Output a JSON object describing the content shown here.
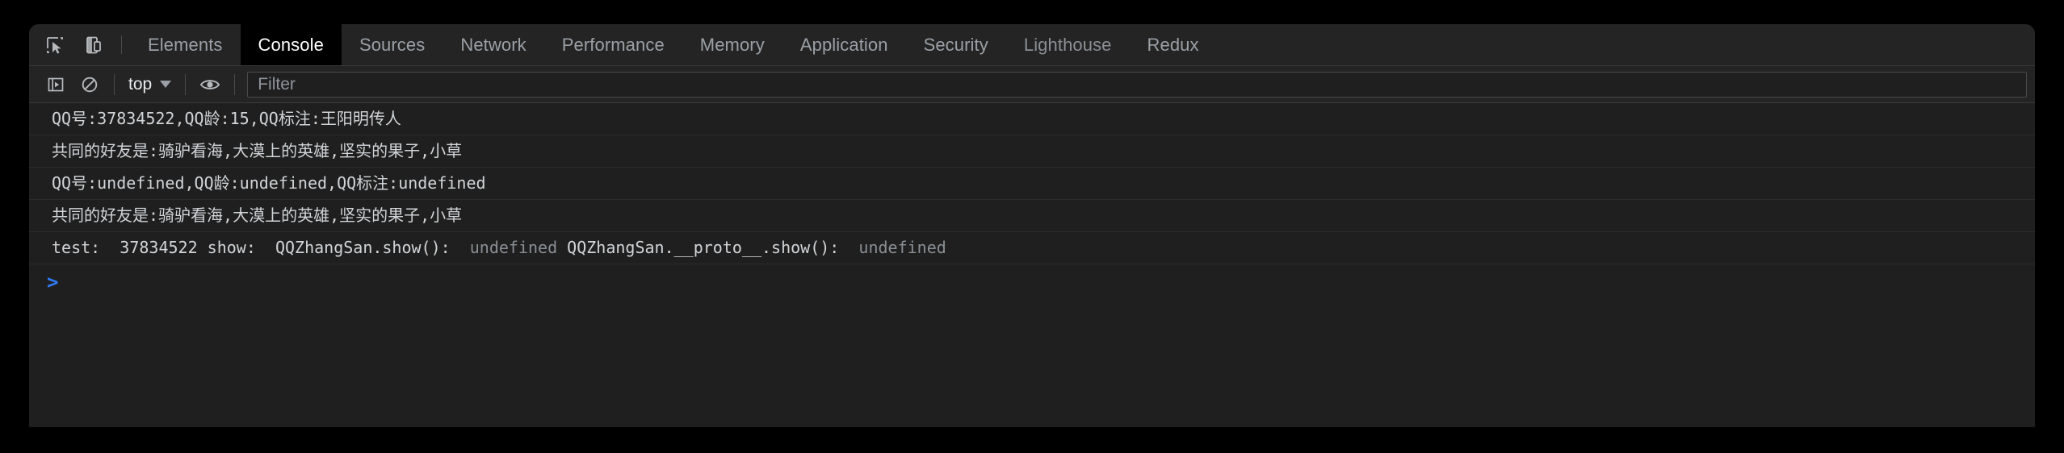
{
  "window": {
    "background_color": "#000000",
    "panel_color": "#242424",
    "console_color": "#1f1f1f"
  },
  "tabbar": {
    "icons": [
      {
        "name": "inspect-element-icon",
        "title": "Inspect element"
      },
      {
        "name": "device-toolbar-icon",
        "title": "Toggle device toolbar"
      }
    ],
    "tabs": [
      {
        "label": "Elements",
        "active": false,
        "dim": false
      },
      {
        "label": "Console",
        "active": true,
        "dim": false
      },
      {
        "label": "Sources",
        "active": false,
        "dim": false
      },
      {
        "label": "Network",
        "active": false,
        "dim": false
      },
      {
        "label": "Performance",
        "active": false,
        "dim": false
      },
      {
        "label": "Memory",
        "active": false,
        "dim": false
      },
      {
        "label": "Application",
        "active": false,
        "dim": false
      },
      {
        "label": "Security",
        "active": false,
        "dim": false
      },
      {
        "label": "Lighthouse",
        "active": false,
        "dim": true
      },
      {
        "label": "Redux",
        "active": false,
        "dim": false
      }
    ]
  },
  "console_toolbar": {
    "sidebar_toggle_icon": "console-sidebar-icon",
    "clear_console_icon": "clear-console-icon",
    "context": {
      "label": "top",
      "caret_icon": "chevron-down-icon"
    },
    "live_expression_icon": "eye-icon",
    "filter": {
      "value": "",
      "placeholder": "Filter"
    }
  },
  "console_log": {
    "accent_color": "#2f7bf6",
    "text_color": "#d2d5d8",
    "muted_color": "#8a8f94",
    "entries": [
      {
        "id": "log-1",
        "segments": [
          {
            "text": "QQ号:37834522,QQ龄:15,QQ标注:王阳明传人",
            "muted": false
          }
        ]
      },
      {
        "id": "log-2",
        "segments": [
          {
            "text": "共同的好友是:骑驴看海,大漠上的英雄,坚实的果子,小草",
            "muted": false
          }
        ]
      },
      {
        "id": "log-3",
        "segments": [
          {
            "text": "QQ号:undefined,QQ龄:undefined,QQ标注:undefined",
            "muted": false
          }
        ]
      },
      {
        "id": "log-4",
        "segments": [
          {
            "text": "共同的好友是:骑驴看海,大漠上的英雄,坚实的果子,小草",
            "muted": false
          }
        ]
      },
      {
        "id": "log-5",
        "segments": [
          {
            "text": "test:  37834522 show:  QQZhangSan.show():  ",
            "muted": false
          },
          {
            "text": "undefined",
            "muted": true
          },
          {
            "text": " QQZhangSan.__proto__.show():  ",
            "muted": false
          },
          {
            "text": "undefined",
            "muted": true
          }
        ]
      }
    ]
  },
  "prompt": {
    "chevron": ">",
    "value": ""
  }
}
